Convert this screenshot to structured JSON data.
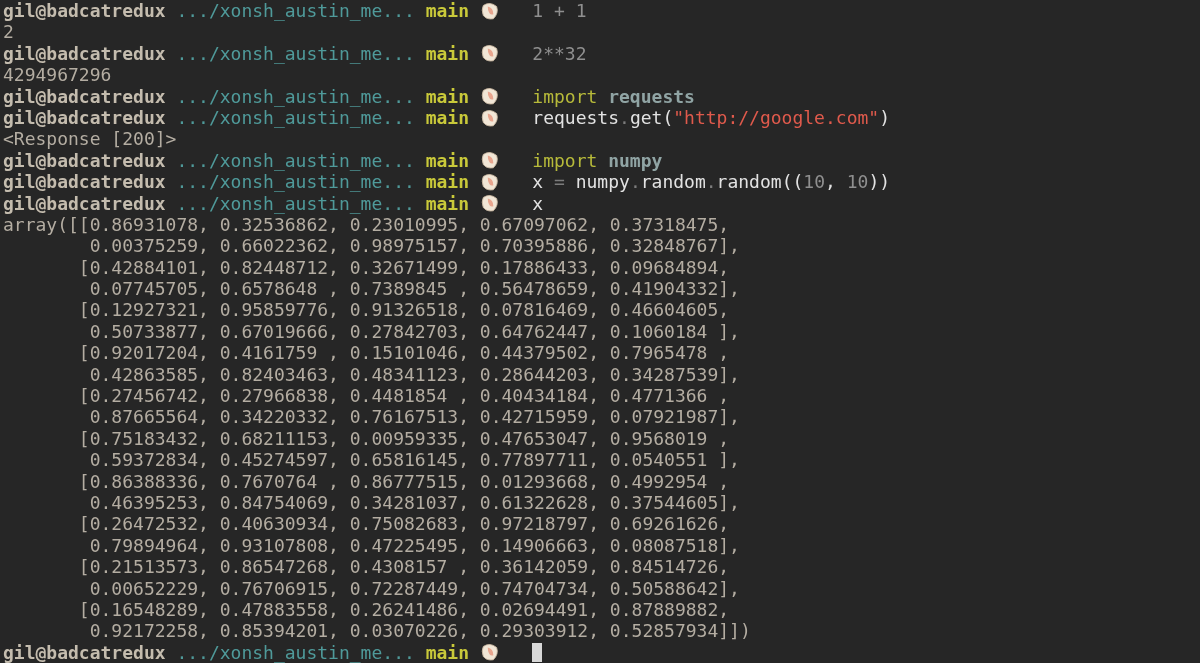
{
  "terminal": {
    "lines": [
      {
        "kind": "prompt",
        "user": "gil@badcatredux",
        "path": ".../xonsh_austin_me...",
        "branch": "main",
        "cursor": false,
        "command": [
          {
            "text": "1 + 1",
            "kind": "number"
          }
        ]
      },
      {
        "kind": "output",
        "text": "2"
      },
      {
        "kind": "prompt",
        "user": "gil@badcatredux",
        "path": ".../xonsh_austin_me...",
        "branch": "main",
        "cursor": false,
        "command": [
          {
            "text": "2**32",
            "kind": "number"
          }
        ]
      },
      {
        "kind": "output",
        "text": "4294967296"
      },
      {
        "kind": "prompt",
        "user": "gil@badcatredux",
        "path": ".../xonsh_austin_me...",
        "branch": "main",
        "cursor": false,
        "command": [
          {
            "text": "import",
            "kind": "keyword"
          },
          {
            "text": " requests",
            "kind": "module"
          }
        ]
      },
      {
        "kind": "prompt",
        "user": "gil@badcatredux",
        "path": ".../xonsh_austin_me...",
        "branch": "main",
        "cursor": false,
        "command": [
          {
            "text": "requests",
            "kind": "plain"
          },
          {
            "text": ".",
            "kind": "punct"
          },
          {
            "text": "get(",
            "kind": "plain"
          },
          {
            "text": "\"http://google.com\"",
            "kind": "string"
          },
          {
            "text": ")",
            "kind": "plain"
          }
        ]
      },
      {
        "kind": "output",
        "text": "<Response [200]>"
      },
      {
        "kind": "prompt",
        "user": "gil@badcatredux",
        "path": ".../xonsh_austin_me...",
        "branch": "main",
        "cursor": false,
        "command": [
          {
            "text": "import",
            "kind": "keyword"
          },
          {
            "text": " numpy",
            "kind": "module"
          }
        ]
      },
      {
        "kind": "prompt",
        "user": "gil@badcatredux",
        "path": ".../xonsh_austin_me...",
        "branch": "main",
        "cursor": false,
        "command": [
          {
            "text": "x ",
            "kind": "plain"
          },
          {
            "text": "=",
            "kind": "punct"
          },
          {
            "text": " numpy",
            "kind": "plain"
          },
          {
            "text": ".",
            "kind": "punct"
          },
          {
            "text": "random",
            "kind": "plain"
          },
          {
            "text": ".",
            "kind": "punct"
          },
          {
            "text": "random((",
            "kind": "plain"
          },
          {
            "text": "10",
            "kind": "number"
          },
          {
            "text": ", ",
            "kind": "plain"
          },
          {
            "text": "10",
            "kind": "number"
          },
          {
            "text": "))",
            "kind": "plain"
          }
        ]
      },
      {
        "kind": "prompt",
        "user": "gil@badcatredux",
        "path": ".../xonsh_austin_me...",
        "branch": "main",
        "cursor": false,
        "command": [
          {
            "text": "x",
            "kind": "plain"
          }
        ]
      },
      {
        "kind": "output",
        "text": "array([[0.86931078, 0.32536862, 0.23010995, 0.67097062, 0.37318475,"
      },
      {
        "kind": "output",
        "text": "        0.00375259, 0.66022362, 0.98975157, 0.70395886, 0.32848767],"
      },
      {
        "kind": "output",
        "text": "       [0.42884101, 0.82448712, 0.32671499, 0.17886433, 0.09684894,"
      },
      {
        "kind": "output",
        "text": "        0.07745705, 0.6578648 , 0.7389845 , 0.56478659, 0.41904332],"
      },
      {
        "kind": "output",
        "text": "       [0.12927321, 0.95859776, 0.91326518, 0.07816469, 0.46604605,"
      },
      {
        "kind": "output",
        "text": "        0.50733877, 0.67019666, 0.27842703, 0.64762447, 0.1060184 ],"
      },
      {
        "kind": "output",
        "text": "       [0.92017204, 0.4161759 , 0.15101046, 0.44379502, 0.7965478 ,"
      },
      {
        "kind": "output",
        "text": "        0.42863585, 0.82403463, 0.48341123, 0.28644203, 0.34287539],"
      },
      {
        "kind": "output",
        "text": "       [0.27456742, 0.27966838, 0.4481854 , 0.40434184, 0.4771366 ,"
      },
      {
        "kind": "output",
        "text": "        0.87665564, 0.34220332, 0.76167513, 0.42715959, 0.07921987],"
      },
      {
        "kind": "output",
        "text": "       [0.75183432, 0.68211153, 0.00959335, 0.47653047, 0.9568019 ,"
      },
      {
        "kind": "output",
        "text": "        0.59372834, 0.45274597, 0.65816145, 0.77897711, 0.0540551 ],"
      },
      {
        "kind": "output",
        "text": "       [0.86388336, 0.7670764 , 0.86777515, 0.01293668, 0.4992954 ,"
      },
      {
        "kind": "output",
        "text": "        0.46395253, 0.84754069, 0.34281037, 0.61322628, 0.37544605],"
      },
      {
        "kind": "output",
        "text": "       [0.26472532, 0.40630934, 0.75082683, 0.97218797, 0.69261626,"
      },
      {
        "kind": "output",
        "text": "        0.79894964, 0.93107808, 0.47225495, 0.14906663, 0.08087518],"
      },
      {
        "kind": "output",
        "text": "       [0.21513573, 0.86547268, 0.4308157 , 0.36142059, 0.84514726,"
      },
      {
        "kind": "output",
        "text": "        0.00652229, 0.76706915, 0.72287449, 0.74704734, 0.50588642],"
      },
      {
        "kind": "output",
        "text": "       [0.16548289, 0.47883558, 0.26241486, 0.02694491, 0.87889882,"
      },
      {
        "kind": "output",
        "text": "        0.92172258, 0.85394201, 0.03070226, 0.29303912, 0.52857934]])"
      },
      {
        "kind": "prompt",
        "user": "gil@badcatredux",
        "path": ".../xonsh_austin_me...",
        "branch": "main",
        "cursor": true
      }
    ]
  }
}
